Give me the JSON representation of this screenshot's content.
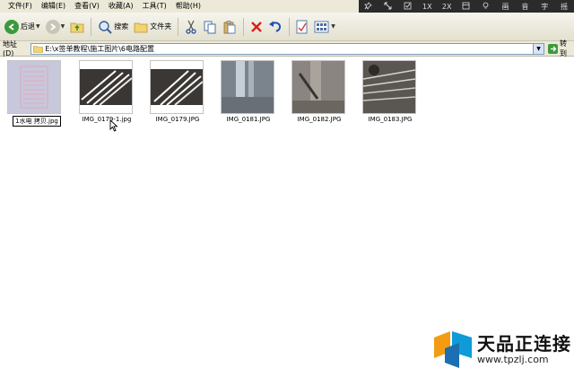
{
  "menu": [
    "文件(F)",
    "编辑(E)",
    "查看(V)",
    "收藏(A)",
    "工具(T)",
    "帮助(H)"
  ],
  "overlay": [
    "1X",
    "2X",
    "画",
    "音",
    "字",
    "摇"
  ],
  "toolbar": {
    "back_label": "后退",
    "search_label": "搜索",
    "folders_label": "文件夹"
  },
  "address": {
    "label": "地址(D)",
    "path": "E:\\x签单教程\\施工图片\\6电路配置",
    "go_label": "转到"
  },
  "files": [
    {
      "name": "1水电 拷贝.jpg",
      "renaming": true
    },
    {
      "name": "IMG_0179-1.jpg",
      "renaming": false
    },
    {
      "name": "IMG_0179.JPG",
      "renaming": false
    },
    {
      "name": "IMG_0181.JPG",
      "renaming": false
    },
    {
      "name": "IMG_0182.JPG",
      "renaming": false
    },
    {
      "name": "IMG_0183.JPG",
      "renaming": false
    }
  ],
  "watermark": {
    "title": "天品正连接",
    "url": "www.tpzlj.com"
  },
  "colors": {
    "chrome": "#ece9d8",
    "overlay": "#2b2b2b",
    "accent_blue": "#316ac5",
    "go_green": "#3b9a3b"
  }
}
